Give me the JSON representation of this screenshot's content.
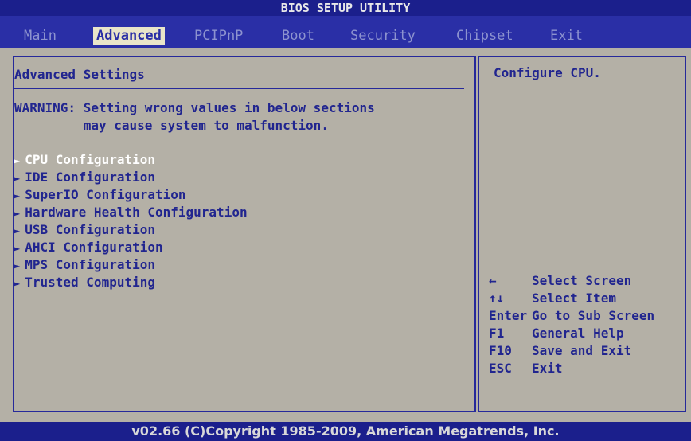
{
  "title": "BIOS SETUP UTILITY",
  "tabs": [
    {
      "label": "Main"
    },
    {
      "label": "Advanced"
    },
    {
      "label": "PCIPnP"
    },
    {
      "label": "Boot"
    },
    {
      "label": "Security"
    },
    {
      "label": "Chipset"
    },
    {
      "label": "Exit"
    }
  ],
  "active_tab": "Advanced",
  "left": {
    "heading": "Advanced Settings",
    "warning_line1": "WARNING: Setting wrong values in below sections",
    "warning_line2": "         may cause system to malfunction.",
    "items": [
      {
        "label": "CPU Configuration"
      },
      {
        "label": "IDE Configuration"
      },
      {
        "label": "SuperIO Configuration"
      },
      {
        "label": "Hardware Health Configuration"
      },
      {
        "label": "USB Configuration"
      },
      {
        "label": "AHCI Configuration"
      },
      {
        "label": "MPS Configuration"
      },
      {
        "label": "Trusted Computing"
      }
    ],
    "selected_item": "CPU Configuration"
  },
  "right": {
    "help": "Configure CPU.",
    "keys": [
      {
        "key": "←",
        "desc": "Select Screen"
      },
      {
        "key": "↑↓",
        "desc": "Select Item"
      },
      {
        "key": "Enter",
        "desc": "Go to Sub Screen"
      },
      {
        "key": "F1",
        "desc": "General Help"
      },
      {
        "key": "F10",
        "desc": "Save and Exit"
      },
      {
        "key": "ESC",
        "desc": "Exit"
      }
    ]
  },
  "footer": "v02.66 (C)Copyright 1985-2009, American Megatrends, Inc.",
  "colors": {
    "background_blue": "#1b1f8c",
    "menubar_blue": "#2a2fa6",
    "panel_gray": "#b4b0a6",
    "text_blue": "#21258f",
    "highlight_white": "#ffffff",
    "tab_highlight": "#e9e5c9"
  }
}
